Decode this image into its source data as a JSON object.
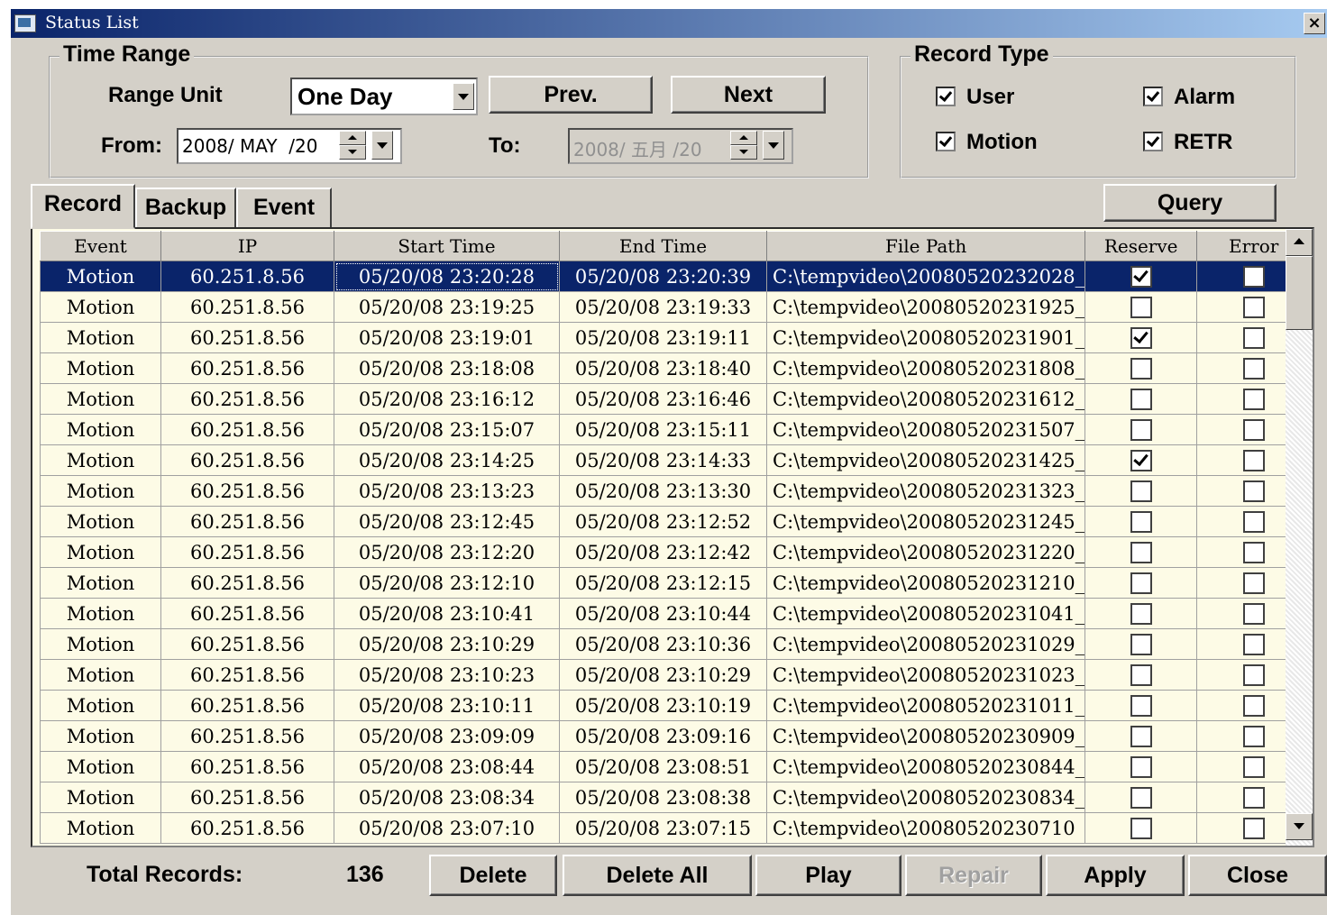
{
  "window": {
    "title": "Status List",
    "close_glyph": "×"
  },
  "time_range": {
    "legend": "Time Range",
    "range_unit_label": "Range Unit",
    "range_unit_value": "One Day",
    "prev_label": "Prev.",
    "next_label": "Next",
    "from_label": "From:",
    "from_value": "2008/ MAY  /20",
    "to_label": "To:",
    "to_value": "2008/ 五月 /20"
  },
  "record_type": {
    "legend": "Record Type",
    "options": [
      {
        "label": "User",
        "checked": true
      },
      {
        "label": "Alarm",
        "checked": true
      },
      {
        "label": "Motion",
        "checked": true
      },
      {
        "label": "RETR",
        "checked": true
      }
    ]
  },
  "tabs": [
    "Record",
    "Backup",
    "Event"
  ],
  "active_tab": "Record",
  "query_label": "Query",
  "table": {
    "columns": [
      "Event",
      "IP",
      "Start Time",
      "End Time",
      "File Path",
      "Reserve",
      "Error"
    ],
    "rows": [
      {
        "event": "Motion",
        "ip": "60.251.8.56",
        "start": "05/20/08 23:20:28",
        "end": "05/20/08 23:20:39",
        "path": "C:\\tempvideo\\20080520232028_",
        "reserve": true,
        "error": false
      },
      {
        "event": "Motion",
        "ip": "60.251.8.56",
        "start": "05/20/08 23:19:25",
        "end": "05/20/08 23:19:33",
        "path": "C:\\tempvideo\\20080520231925_",
        "reserve": false,
        "error": false
      },
      {
        "event": "Motion",
        "ip": "60.251.8.56",
        "start": "05/20/08 23:19:01",
        "end": "05/20/08 23:19:11",
        "path": "C:\\tempvideo\\20080520231901_",
        "reserve": true,
        "error": false
      },
      {
        "event": "Motion",
        "ip": "60.251.8.56",
        "start": "05/20/08 23:18:08",
        "end": "05/20/08 23:18:40",
        "path": "C:\\tempvideo\\20080520231808_",
        "reserve": false,
        "error": false
      },
      {
        "event": "Motion",
        "ip": "60.251.8.56",
        "start": "05/20/08 23:16:12",
        "end": "05/20/08 23:16:46",
        "path": "C:\\tempvideo\\20080520231612_",
        "reserve": false,
        "error": false
      },
      {
        "event": "Motion",
        "ip": "60.251.8.56",
        "start": "05/20/08 23:15:07",
        "end": "05/20/08 23:15:11",
        "path": "C:\\tempvideo\\20080520231507_",
        "reserve": false,
        "error": false
      },
      {
        "event": "Motion",
        "ip": "60.251.8.56",
        "start": "05/20/08 23:14:25",
        "end": "05/20/08 23:14:33",
        "path": "C:\\tempvideo\\20080520231425_",
        "reserve": true,
        "error": false
      },
      {
        "event": "Motion",
        "ip": "60.251.8.56",
        "start": "05/20/08 23:13:23",
        "end": "05/20/08 23:13:30",
        "path": "C:\\tempvideo\\20080520231323_",
        "reserve": false,
        "error": false
      },
      {
        "event": "Motion",
        "ip": "60.251.8.56",
        "start": "05/20/08 23:12:45",
        "end": "05/20/08 23:12:52",
        "path": "C:\\tempvideo\\20080520231245_",
        "reserve": false,
        "error": false
      },
      {
        "event": "Motion",
        "ip": "60.251.8.56",
        "start": "05/20/08 23:12:20",
        "end": "05/20/08 23:12:42",
        "path": "C:\\tempvideo\\20080520231220_",
        "reserve": false,
        "error": false
      },
      {
        "event": "Motion",
        "ip": "60.251.8.56",
        "start": "05/20/08 23:12:10",
        "end": "05/20/08 23:12:15",
        "path": "C:\\tempvideo\\20080520231210_",
        "reserve": false,
        "error": false
      },
      {
        "event": "Motion",
        "ip": "60.251.8.56",
        "start": "05/20/08 23:10:41",
        "end": "05/20/08 23:10:44",
        "path": "C:\\tempvideo\\20080520231041_",
        "reserve": false,
        "error": false
      },
      {
        "event": "Motion",
        "ip": "60.251.8.56",
        "start": "05/20/08 23:10:29",
        "end": "05/20/08 23:10:36",
        "path": "C:\\tempvideo\\20080520231029_",
        "reserve": false,
        "error": false
      },
      {
        "event": "Motion",
        "ip": "60.251.8.56",
        "start": "05/20/08 23:10:23",
        "end": "05/20/08 23:10:29",
        "path": "C:\\tempvideo\\20080520231023_",
        "reserve": false,
        "error": false
      },
      {
        "event": "Motion",
        "ip": "60.251.8.56",
        "start": "05/20/08 23:10:11",
        "end": "05/20/08 23:10:19",
        "path": "C:\\tempvideo\\20080520231011_",
        "reserve": false,
        "error": false
      },
      {
        "event": "Motion",
        "ip": "60.251.8.56",
        "start": "05/20/08 23:09:09",
        "end": "05/20/08 23:09:16",
        "path": "C:\\tempvideo\\20080520230909_",
        "reserve": false,
        "error": false
      },
      {
        "event": "Motion",
        "ip": "60.251.8.56",
        "start": "05/20/08 23:08:44",
        "end": "05/20/08 23:08:51",
        "path": "C:\\tempvideo\\20080520230844_",
        "reserve": false,
        "error": false
      },
      {
        "event": "Motion",
        "ip": "60.251.8.56",
        "start": "05/20/08 23:08:34",
        "end": "05/20/08 23:08:38",
        "path": "C:\\tempvideo\\20080520230834_",
        "reserve": false,
        "error": false
      },
      {
        "event": "Motion",
        "ip": "60.251.8.56",
        "start": "05/20/08 23:07:10",
        "end": "05/20/08 23:07:15",
        "path": "C:\\tempvideo\\20080520230710",
        "reserve": false,
        "error": false
      }
    ]
  },
  "footer": {
    "total_label": "Total Records:",
    "total_value": "136",
    "buttons": [
      {
        "label": "Delete",
        "enabled": true
      },
      {
        "label": "Delete All",
        "enabled": true
      },
      {
        "label": "Play",
        "enabled": true
      },
      {
        "label": "Repair",
        "enabled": false
      },
      {
        "label": "Apply",
        "enabled": true
      },
      {
        "label": "Close",
        "enabled": true
      }
    ]
  }
}
